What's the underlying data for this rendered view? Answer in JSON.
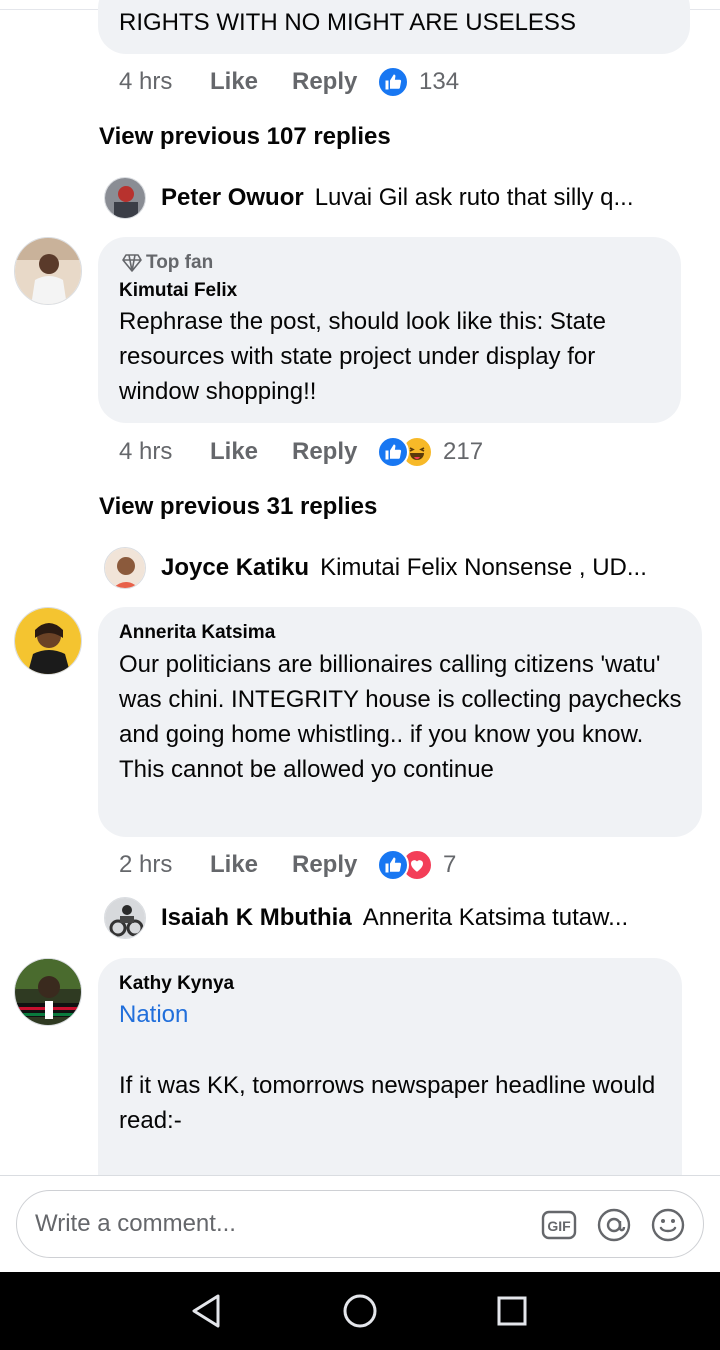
{
  "comments": [
    {
      "text": "RIGHTS WITH NO MIGHT ARE USELESS",
      "time": "4 hrs",
      "like_label": "Like",
      "reply_label": "Reply",
      "reactions": [
        "like-icon"
      ],
      "reaction_count": "134",
      "view_previous": "View previous 107 replies",
      "last_reply": {
        "name": "Peter Owuor",
        "preview": "Luvai Gil ask ruto that silly q..."
      }
    },
    {
      "badge": "Top fan",
      "author": "Kimutai Felix",
      "text": "Rephrase the post, should look like this: State resources with state project under display for window shopping!!",
      "time": "4 hrs",
      "like_label": "Like",
      "reply_label": "Reply",
      "reactions": [
        "like-icon",
        "haha-icon"
      ],
      "reaction_count": "217",
      "view_previous": "View previous 31 replies",
      "last_reply": {
        "name": "Joyce Katiku",
        "preview": "Kimutai Felix Nonsense , UD..."
      }
    },
    {
      "author": "Annerita Katsima",
      "text": "Our politicians are billionaires calling citizens 'watu' was chini. INTEGRITY house is collecting paychecks and going home whistling.. if you know you know. This cannot be allowed yo continue",
      "time": "2 hrs",
      "like_label": "Like",
      "reply_label": "Reply",
      "reactions": [
        "like-icon",
        "love-icon"
      ],
      "reaction_count": "7",
      "last_reply": {
        "name": "Isaiah K Mbuthia",
        "preview": "Annerita Katsima tutaw..."
      }
    },
    {
      "author": "Kathy Kynya",
      "mention": "Nation",
      "text": "If it was KK, tomorrows newspaper headline would read:-"
    }
  ],
  "composer": {
    "placeholder": "Write a comment...",
    "icons": [
      "gif-icon",
      "mention-icon",
      "emoji-icon"
    ]
  },
  "system_nav": [
    "back-icon",
    "home-icon",
    "recents-icon"
  ],
  "colors": {
    "bubble": "#f0f2f5",
    "like_blue": "#1877f2",
    "link_blue": "#216fdb",
    "secondary_text": "#65676b",
    "love_red": "#f33e58",
    "haha_yellow": "#f7b928"
  }
}
